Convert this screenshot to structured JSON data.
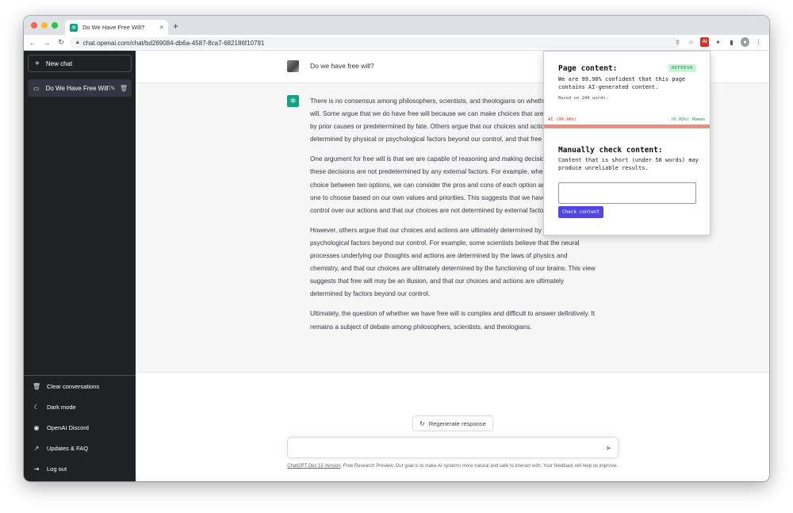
{
  "browser": {
    "tab_title": "Do We Have Free Will?",
    "tab_close": "×",
    "new_tab": "+",
    "url": "chat.openai.com/chat/bd269084-db6a-4587-8ca7-682186f10791"
  },
  "sidebar": {
    "new_chat": "New chat",
    "conversations": [
      {
        "title": "Do We Have Free Will?"
      }
    ],
    "bottom_items": [
      {
        "label": "Clear conversations",
        "icon": "trash-icon"
      },
      {
        "label": "Dark mode",
        "icon": "moon-icon"
      },
      {
        "label": "OpenAI Discord",
        "icon": "discord-icon"
      },
      {
        "label": "Updates & FAQ",
        "icon": "external-link-icon"
      },
      {
        "label": "Log out",
        "icon": "logout-icon"
      }
    ]
  },
  "chat": {
    "user_message": "Do we have free will?",
    "assistant_paragraphs": [
      "There is no consensus among philosophers, scientists, and theologians on whether we have free will. Some argue that we do have free will because we can make choices that are not determined by prior causes or predetermined by fate. Others argue that our choices and actions are ultimately determined by physical or psychological factors beyond our control, and that free will is an illusion.",
      "One argument for free will is that we are capable of reasoning and making decisions, and that these decisions are not predetermined by any external factors. For example, when faced with a choice between two options, we can consider the pros and cons of each option and decide which one to choose based on our own values and priorities. This suggests that we have some degree of control over our actions and that our choices are not determined by external factors.",
      "However, others argue that our choices and actions are ultimately determined by physical or psychological factors beyond our control. For example, some scientists believe that the neural processes underlying our thoughts and actions are determined by the laws of physics and chemistry, and that our choices are ultimately determined by the functioning of our brains. This view suggests that free will may be an illusion, and that our choices and actions are ultimately determined by factors beyond our control.",
      "Ultimately, the question of whether we have free will is complex and difficult to answer definitively. It remains a subject of debate among philosophers, scientists, and theologians."
    ],
    "regenerate_label": "Regenerate response",
    "footer_link": "ChatGPT Dec 15 Version",
    "footer_text": ". Free Research Preview. Our goal is to make AI systems more natural and safe to interact with. Your feedback will help us improve."
  },
  "extension": {
    "page_content_title": "Page content:",
    "refresh_label": "REFRESH",
    "confidence_text": "We are 99.98% confident that this page contains AI-generated content.",
    "based_on": "Based on 244 words.",
    "ai_label": "AI (99.98%)",
    "human_label": "(0.02%) Human",
    "ai_fraction": 0.9998,
    "manual_title": "Manually check content:",
    "manual_text": "Content that is short (under 50 words) may produce unreliable results.",
    "check_button": "Check content",
    "textarea_value": ""
  },
  "colors": {
    "sidebar_bg": "#202123",
    "accent_green": "#10a37f",
    "check_button": "#4f46e5",
    "ai_red": "#d93025",
    "human_green": "#1e8e3e"
  }
}
